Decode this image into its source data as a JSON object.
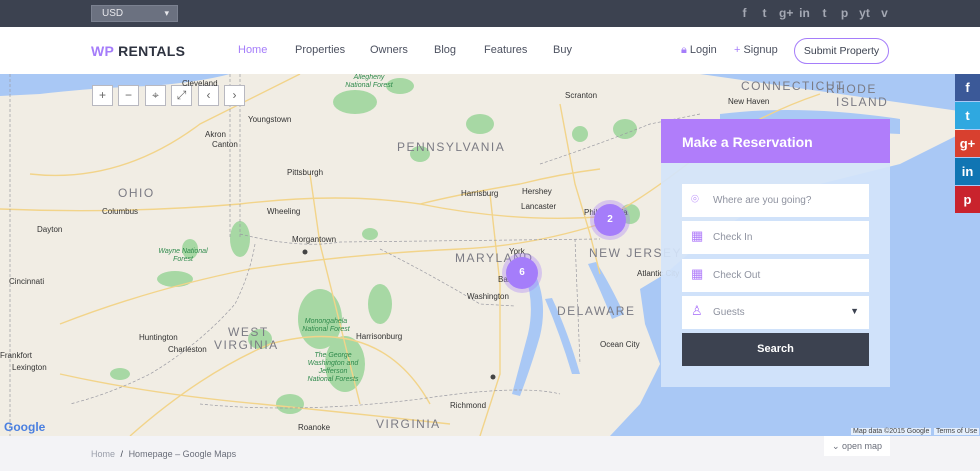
{
  "topbar": {
    "currency": "USD",
    "socials": [
      "f",
      "t",
      "g+",
      "in",
      "t",
      "p",
      "yt",
      "v"
    ]
  },
  "header": {
    "logo_a": "WP",
    "logo_b": "RENTALS",
    "nav": [
      "Home",
      "Properties",
      "Owners",
      "Blog",
      "Features",
      "Buy"
    ],
    "login": "Login",
    "signup": "Signup",
    "submit": "Submit Property"
  },
  "map": {
    "controls": [
      "+",
      "−",
      "⌖",
      "⤢",
      "‹",
      "›"
    ],
    "clusters": [
      "2",
      "6"
    ],
    "google": "Google",
    "attribution": "Map data ©2015 Google",
    "terms": "Terms of Use",
    "states": [
      "PENNSYLVANIA",
      "OHIO",
      "MARYLAND",
      "NEW JERSEY",
      "DELAWARE",
      "WEST",
      "VIRGINIA",
      "VIRGINIA",
      "CONNECTICUT",
      "RHODE",
      "ISLAND"
    ],
    "cities": [
      "Pittsburgh",
      "Columbus",
      "Dayton",
      "Cincinnati",
      "Akron",
      "Canton",
      "Youngstown",
      "Cleveland",
      "Wheeling",
      "Morgantown",
      "Harrisburg",
      "Hershey",
      "Lancaster",
      "Philadelphia",
      "Baltimore",
      "Washington",
      "Scranton",
      "New Haven",
      "Atlantic City",
      "Ocean City",
      "Richmond",
      "Roanoke",
      "Charleston",
      "Huntington",
      "Harrisonburg",
      "Lexington",
      "Frankfort",
      "York",
      "Allegheny National Forest",
      "Wayne National Forest",
      "Monongahela National Forest",
      "The George Washington and Jefferson National Forests"
    ]
  },
  "reservation": {
    "title": "Make a Reservation",
    "where": "Where are you going?",
    "checkin": "Check In",
    "checkout": "Check Out",
    "guests": "Guests",
    "search": "Search"
  },
  "side_social": [
    "f",
    "t",
    "g+",
    "in",
    "p"
  ],
  "breadcrumb": {
    "home": "Home",
    "sep": "/",
    "current": "Homepage – Google Maps"
  },
  "open_map": "open map",
  "colors": {
    "accent": "#a57dfa",
    "dark": "#3c4250",
    "facebook": "#3b5998",
    "twitter": "#2fa8e0",
    "google": "#d8402f",
    "linkedin": "#1075b3",
    "pinterest": "#c9232d"
  }
}
